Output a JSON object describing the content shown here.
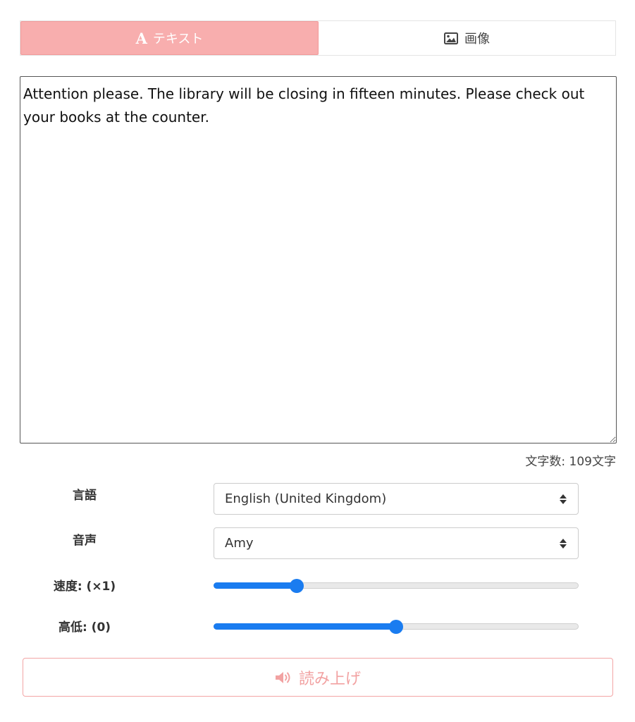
{
  "tabs": {
    "text_label": "テキスト",
    "text_glyph": "A",
    "text_icon": "letter-a-icon",
    "image_label": "画像",
    "image_icon": "image-icon"
  },
  "editor": {
    "value": "Attention please. The library will be closing in fifteen minutes. Please check out your books at the counter."
  },
  "char_count": "文字数: 109文字",
  "language": {
    "label": "言語",
    "selected": "English (United Kingdom)"
  },
  "voice": {
    "label": "音声",
    "selected": "Amy"
  },
  "speed": {
    "label": "速度: (×1)",
    "fraction": 0.227
  },
  "pitch": {
    "label": "高低: (0)",
    "fraction": 0.5
  },
  "read_button": {
    "label": "読み上げ",
    "icon": "speaker-icon"
  },
  "colors": {
    "accent_pink": "#f8aeae",
    "slider_blue": "#1a7cf0"
  }
}
